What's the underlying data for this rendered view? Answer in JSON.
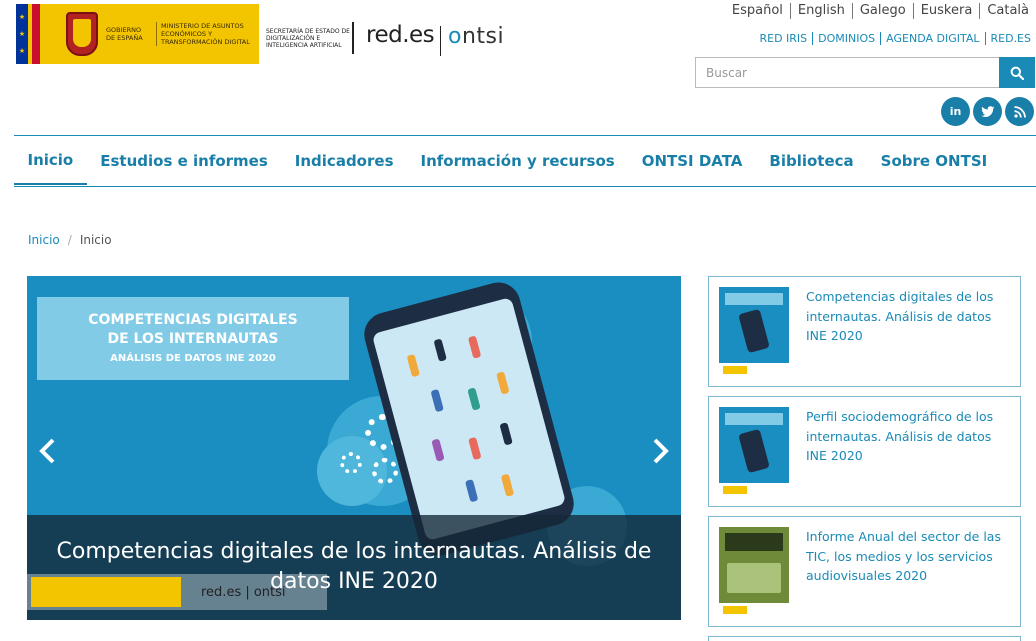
{
  "header": {
    "gov_text": "GOBIERNO DE ESPAÑA",
    "ministry_text": "MINISTERIO DE ASUNTOS ECONÓMICOS Y TRANSFORMACIÓN DIGITAL",
    "secretaria_text": "SECRETARÍA DE ESTADO DE DIGITALIZACIÓN E INTELIGENCIA ARTIFICIAL",
    "rede_brand": "red.es",
    "ontsi_brand_o": "o",
    "ontsi_brand_rest": "ntsi",
    "languages": [
      "Español",
      "English",
      "Galego",
      "Euskera",
      "Català"
    ],
    "top_links": [
      "RED IRIS",
      "DOMINIOS",
      "AGENDA DIGITAL",
      "RED.ES"
    ],
    "search_placeholder": "Buscar",
    "social": [
      "in"
    ]
  },
  "nav": {
    "items": [
      "Inicio",
      "Estudios e informes",
      "Indicadores",
      "Información y recursos",
      "ONTSI DATA",
      "Biblioteca",
      "Sobre ONTSI"
    ],
    "active_index": 0
  },
  "breadcrumb": {
    "items": [
      "Inicio",
      "Inicio"
    ],
    "separator": "/"
  },
  "carousel": {
    "banner_line1": "COMPETENCIAS DIGITALES",
    "banner_line2": "DE LOS INTERNAUTAS",
    "banner_line3": "ANÁLISIS DE DATOS INE 2020",
    "caption": "Competencias digitales de los internautas. Análisis de datos INE 2020",
    "mini_logo_text": "red.es | ontsi"
  },
  "sidebar": {
    "cards": [
      {
        "title": "Competencias digitales de los internautas. Análisis de datos INE 2020"
      },
      {
        "title": "Perfil sociodemográfico de los internautas. Análisis de datos INE 2020"
      },
      {
        "title": "Informe Anual del sector de las TIC, los medios y los servicios audiovisuales 2020"
      }
    ]
  },
  "colors": {
    "accent": "#1a8ab6",
    "gov_yellow": "#f2c500",
    "slide_bg": "#1a8ec0"
  }
}
